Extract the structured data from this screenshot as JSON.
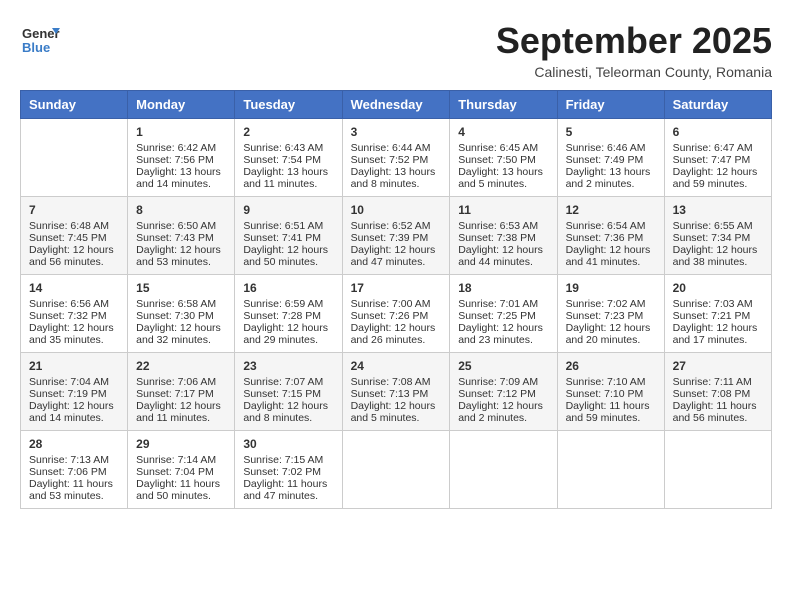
{
  "header": {
    "logo_general": "General",
    "logo_blue": "Blue",
    "month_title": "September 2025",
    "subtitle": "Calinesti, Teleorman County, Romania"
  },
  "calendar": {
    "headers": [
      "Sunday",
      "Monday",
      "Tuesday",
      "Wednesday",
      "Thursday",
      "Friday",
      "Saturday"
    ],
    "weeks": [
      [
        {
          "day": "",
          "content": ""
        },
        {
          "day": "1",
          "content": "Sunrise: 6:42 AM\nSunset: 7:56 PM\nDaylight: 13 hours\nand 14 minutes."
        },
        {
          "day": "2",
          "content": "Sunrise: 6:43 AM\nSunset: 7:54 PM\nDaylight: 13 hours\nand 11 minutes."
        },
        {
          "day": "3",
          "content": "Sunrise: 6:44 AM\nSunset: 7:52 PM\nDaylight: 13 hours\nand 8 minutes."
        },
        {
          "day": "4",
          "content": "Sunrise: 6:45 AM\nSunset: 7:50 PM\nDaylight: 13 hours\nand 5 minutes."
        },
        {
          "day": "5",
          "content": "Sunrise: 6:46 AM\nSunset: 7:49 PM\nDaylight: 13 hours\nand 2 minutes."
        },
        {
          "day": "6",
          "content": "Sunrise: 6:47 AM\nSunset: 7:47 PM\nDaylight: 12 hours\nand 59 minutes."
        }
      ],
      [
        {
          "day": "7",
          "content": "Sunrise: 6:48 AM\nSunset: 7:45 PM\nDaylight: 12 hours\nand 56 minutes."
        },
        {
          "day": "8",
          "content": "Sunrise: 6:50 AM\nSunset: 7:43 PM\nDaylight: 12 hours\nand 53 minutes."
        },
        {
          "day": "9",
          "content": "Sunrise: 6:51 AM\nSunset: 7:41 PM\nDaylight: 12 hours\nand 50 minutes."
        },
        {
          "day": "10",
          "content": "Sunrise: 6:52 AM\nSunset: 7:39 PM\nDaylight: 12 hours\nand 47 minutes."
        },
        {
          "day": "11",
          "content": "Sunrise: 6:53 AM\nSunset: 7:38 PM\nDaylight: 12 hours\nand 44 minutes."
        },
        {
          "day": "12",
          "content": "Sunrise: 6:54 AM\nSunset: 7:36 PM\nDaylight: 12 hours\nand 41 minutes."
        },
        {
          "day": "13",
          "content": "Sunrise: 6:55 AM\nSunset: 7:34 PM\nDaylight: 12 hours\nand 38 minutes."
        }
      ],
      [
        {
          "day": "14",
          "content": "Sunrise: 6:56 AM\nSunset: 7:32 PM\nDaylight: 12 hours\nand 35 minutes."
        },
        {
          "day": "15",
          "content": "Sunrise: 6:58 AM\nSunset: 7:30 PM\nDaylight: 12 hours\nand 32 minutes."
        },
        {
          "day": "16",
          "content": "Sunrise: 6:59 AM\nSunset: 7:28 PM\nDaylight: 12 hours\nand 29 minutes."
        },
        {
          "day": "17",
          "content": "Sunrise: 7:00 AM\nSunset: 7:26 PM\nDaylight: 12 hours\nand 26 minutes."
        },
        {
          "day": "18",
          "content": "Sunrise: 7:01 AM\nSunset: 7:25 PM\nDaylight: 12 hours\nand 23 minutes."
        },
        {
          "day": "19",
          "content": "Sunrise: 7:02 AM\nSunset: 7:23 PM\nDaylight: 12 hours\nand 20 minutes."
        },
        {
          "day": "20",
          "content": "Sunrise: 7:03 AM\nSunset: 7:21 PM\nDaylight: 12 hours\nand 17 minutes."
        }
      ],
      [
        {
          "day": "21",
          "content": "Sunrise: 7:04 AM\nSunset: 7:19 PM\nDaylight: 12 hours\nand 14 minutes."
        },
        {
          "day": "22",
          "content": "Sunrise: 7:06 AM\nSunset: 7:17 PM\nDaylight: 12 hours\nand 11 minutes."
        },
        {
          "day": "23",
          "content": "Sunrise: 7:07 AM\nSunset: 7:15 PM\nDaylight: 12 hours\nand 8 minutes."
        },
        {
          "day": "24",
          "content": "Sunrise: 7:08 AM\nSunset: 7:13 PM\nDaylight: 12 hours\nand 5 minutes."
        },
        {
          "day": "25",
          "content": "Sunrise: 7:09 AM\nSunset: 7:12 PM\nDaylight: 12 hours\nand 2 minutes."
        },
        {
          "day": "26",
          "content": "Sunrise: 7:10 AM\nSunset: 7:10 PM\nDaylight: 11 hours\nand 59 minutes."
        },
        {
          "day": "27",
          "content": "Sunrise: 7:11 AM\nSunset: 7:08 PM\nDaylight: 11 hours\nand 56 minutes."
        }
      ],
      [
        {
          "day": "28",
          "content": "Sunrise: 7:13 AM\nSunset: 7:06 PM\nDaylight: 11 hours\nand 53 minutes."
        },
        {
          "day": "29",
          "content": "Sunrise: 7:14 AM\nSunset: 7:04 PM\nDaylight: 11 hours\nand 50 minutes."
        },
        {
          "day": "30",
          "content": "Sunrise: 7:15 AM\nSunset: 7:02 PM\nDaylight: 11 hours\nand 47 minutes."
        },
        {
          "day": "",
          "content": ""
        },
        {
          "day": "",
          "content": ""
        },
        {
          "day": "",
          "content": ""
        },
        {
          "day": "",
          "content": ""
        }
      ]
    ]
  }
}
